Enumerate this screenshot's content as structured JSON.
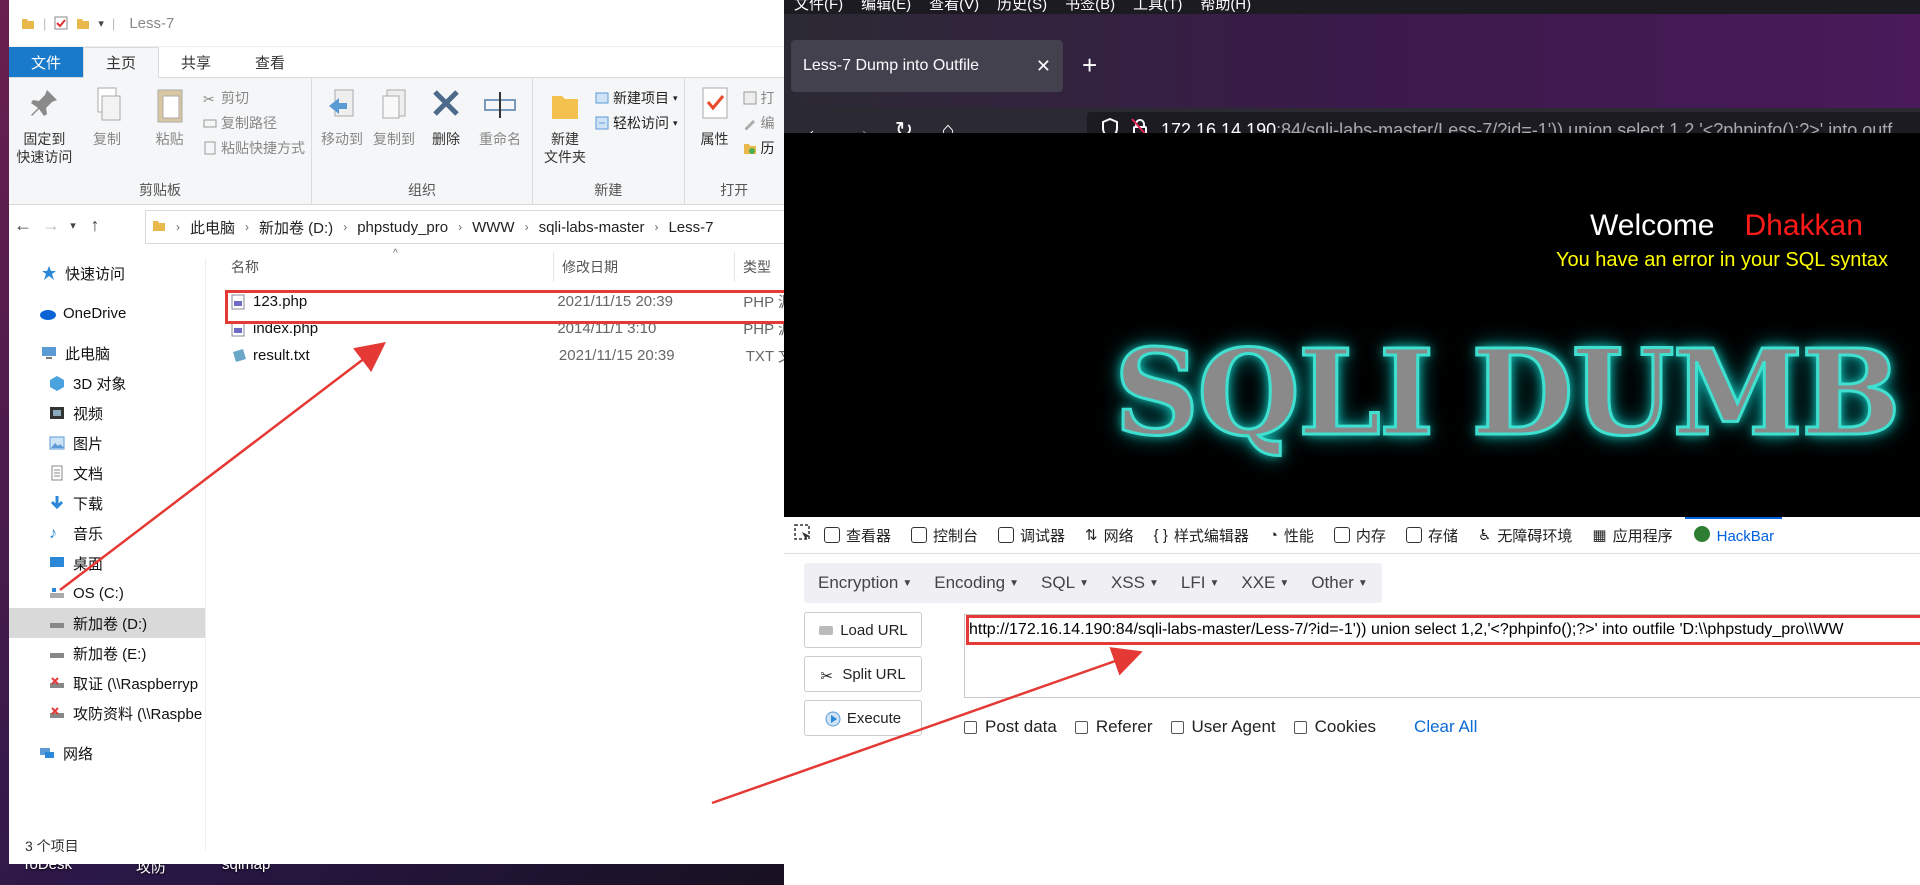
{
  "taskbar": {
    "labels": [
      "ToDesk",
      "攻防",
      "sqlmap"
    ]
  },
  "explorer": {
    "window_title": "Less-7",
    "ribbon_tabs": [
      "文件",
      "主页",
      "共享",
      "查看"
    ],
    "groups": {
      "clipboard": {
        "label": "剪贴板",
        "pin": "固定到\n快速访问",
        "copy": "复制",
        "paste": "粘贴",
        "cut": "剪切",
        "copy_path": "复制路径",
        "paste_shortcut": "粘贴快捷方式"
      },
      "organize": {
        "label": "组织",
        "move_to": "移动到",
        "copy_to": "复制到",
        "delete": "删除",
        "rename": "重命名"
      },
      "new": {
        "label": "新建",
        "new_folder": "新建\n文件夹",
        "new_item": "新建项目",
        "easy_access": "轻松访问"
      },
      "open": {
        "label": "打开",
        "properties": "属性",
        "open_partial": "打",
        "edit_partial": "编",
        "history_partial": "历"
      }
    },
    "breadcrumb": [
      "此电脑",
      "新加卷 (D:)",
      "phpstudy_pro",
      "WWW",
      "sqli-labs-master",
      "Less-7"
    ],
    "nav_items": [
      {
        "label": "快速访问"
      },
      {
        "label": "OneDrive"
      },
      {
        "label": "此电脑"
      },
      {
        "label": "3D 对象"
      },
      {
        "label": "视频"
      },
      {
        "label": "图片"
      },
      {
        "label": "文档"
      },
      {
        "label": "下载"
      },
      {
        "label": "音乐"
      },
      {
        "label": "桌面"
      },
      {
        "label": "OS (C:)"
      },
      {
        "label": "新加卷 (D:)"
      },
      {
        "label": "新加卷 (E:)"
      },
      {
        "label": "取证 (\\\\Raspberryp"
      },
      {
        "label": "攻防资料 (\\\\Raspbe"
      },
      {
        "label": "网络"
      }
    ],
    "columns": [
      "名称",
      "修改日期",
      "类型"
    ],
    "files": [
      {
        "name": "123.php",
        "date": "2021/11/15 20:39",
        "type": "PHP 源"
      },
      {
        "name": "index.php",
        "date": "2014/11/1 3:10",
        "type": "PHP 源"
      },
      {
        "name": "result.txt",
        "date": "2021/11/15 20:39",
        "type": "TXT 文"
      }
    ],
    "status": "3 个项目"
  },
  "browser": {
    "menu": [
      "文件(F)",
      "编辑(E)",
      "查看(V)",
      "历史(S)",
      "书签(B)",
      "工具(T)",
      "帮助(H)"
    ],
    "tab_title": "Less-7 Dump into Outfile",
    "url_host": "172.16.14.190",
    "url_rest": ":84/sqli-labs-master/Less-7/?id=-1')) union select 1,2,'<?phpinfo();?>' into outf",
    "page": {
      "welcome": "Welcome",
      "user": "Dhakkan",
      "error": "You have an error in your SQL syntax",
      "banner": "SQLI DUMB SE"
    },
    "devtools_tabs": [
      "查看器",
      "控制台",
      "调试器",
      "网络",
      "样式编辑器",
      "性能",
      "内存",
      "存储",
      "无障碍环境",
      "应用程序",
      "HackBar"
    ],
    "hackbar": {
      "menus": [
        "Encryption",
        "Encoding",
        "SQL",
        "XSS",
        "LFI",
        "XXE",
        "Other"
      ],
      "load_url": "Load URL",
      "split_url": "Split URL",
      "execute": "Execute",
      "url_value": "http://172.16.14.190:84/sqli-labs-master/Less-7/?id=-1')) union select 1,2,'<?phpinfo();?>' into outfile 'D:\\\\phpstudy_pro\\\\WW",
      "options": [
        "Post data",
        "Referer",
        "User Agent",
        "Cookies"
      ],
      "clear_all": "Clear All"
    }
  },
  "colors": {
    "annotation_red": "#e53935",
    "explorer_accent": "#1979ca",
    "devtools_accent": "#0061e0",
    "welcome_user": "#ff1a1a",
    "sql_error": "#ffff00"
  }
}
